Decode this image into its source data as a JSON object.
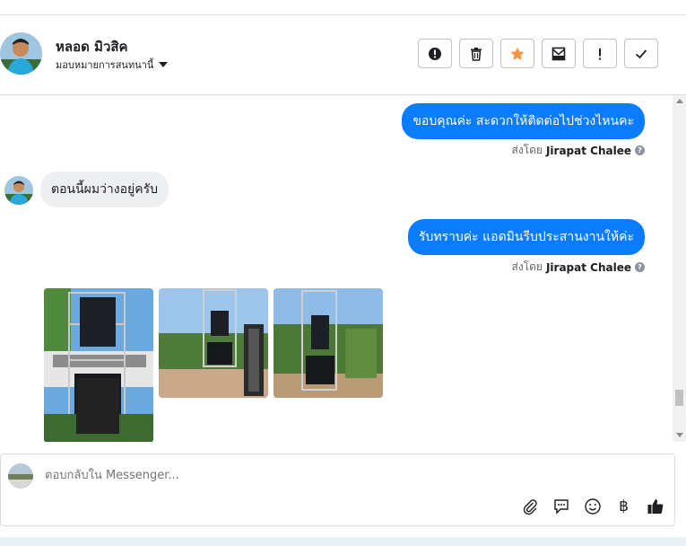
{
  "header": {
    "contact_name": "หลอด มิวสิค",
    "assign_label": "มอบหมายการสนทนานี้",
    "toolbar": [
      {
        "name": "report-button",
        "icon": "exclamation-circle-icon"
      },
      {
        "name": "delete-button",
        "icon": "trash-icon"
      },
      {
        "name": "star-button",
        "icon": "star-icon"
      },
      {
        "name": "archive-button",
        "icon": "mail-box-icon"
      },
      {
        "name": "mark-important-button",
        "icon": "exclamation-icon"
      },
      {
        "name": "mark-done-button",
        "icon": "check-icon"
      }
    ]
  },
  "thread": {
    "messages": [
      {
        "direction": "out",
        "text": "ขอบคุณค่ะ สะดวกให้ติดต่อไปช่วงไหนคะ",
        "sent_by_prefix": "ส่งโดย",
        "sent_by_name": "Jirapat Chalee"
      },
      {
        "direction": "in",
        "text": "ตอนนี้ผมว่างอยู่ครับ"
      },
      {
        "direction": "out",
        "text": "รับทราบค่ะ แอดมินรีบประสานงานให้ค่ะ",
        "sent_by_prefix": "ส่งโดย",
        "sent_by_name": "Jirapat Chalee"
      }
    ],
    "photos_count": 3
  },
  "composer": {
    "placeholder": "ตอบกลับใน Messenger...",
    "icons": [
      "paperclip-icon",
      "chat-bubble-icon",
      "smiley-icon",
      "baht-icon",
      "thumbs-up-icon"
    ],
    "baht_symbol": "฿"
  },
  "colors": {
    "accent": "#0a7cff",
    "star": "#f7923b",
    "incoming_bubble": "#eeeff1"
  }
}
